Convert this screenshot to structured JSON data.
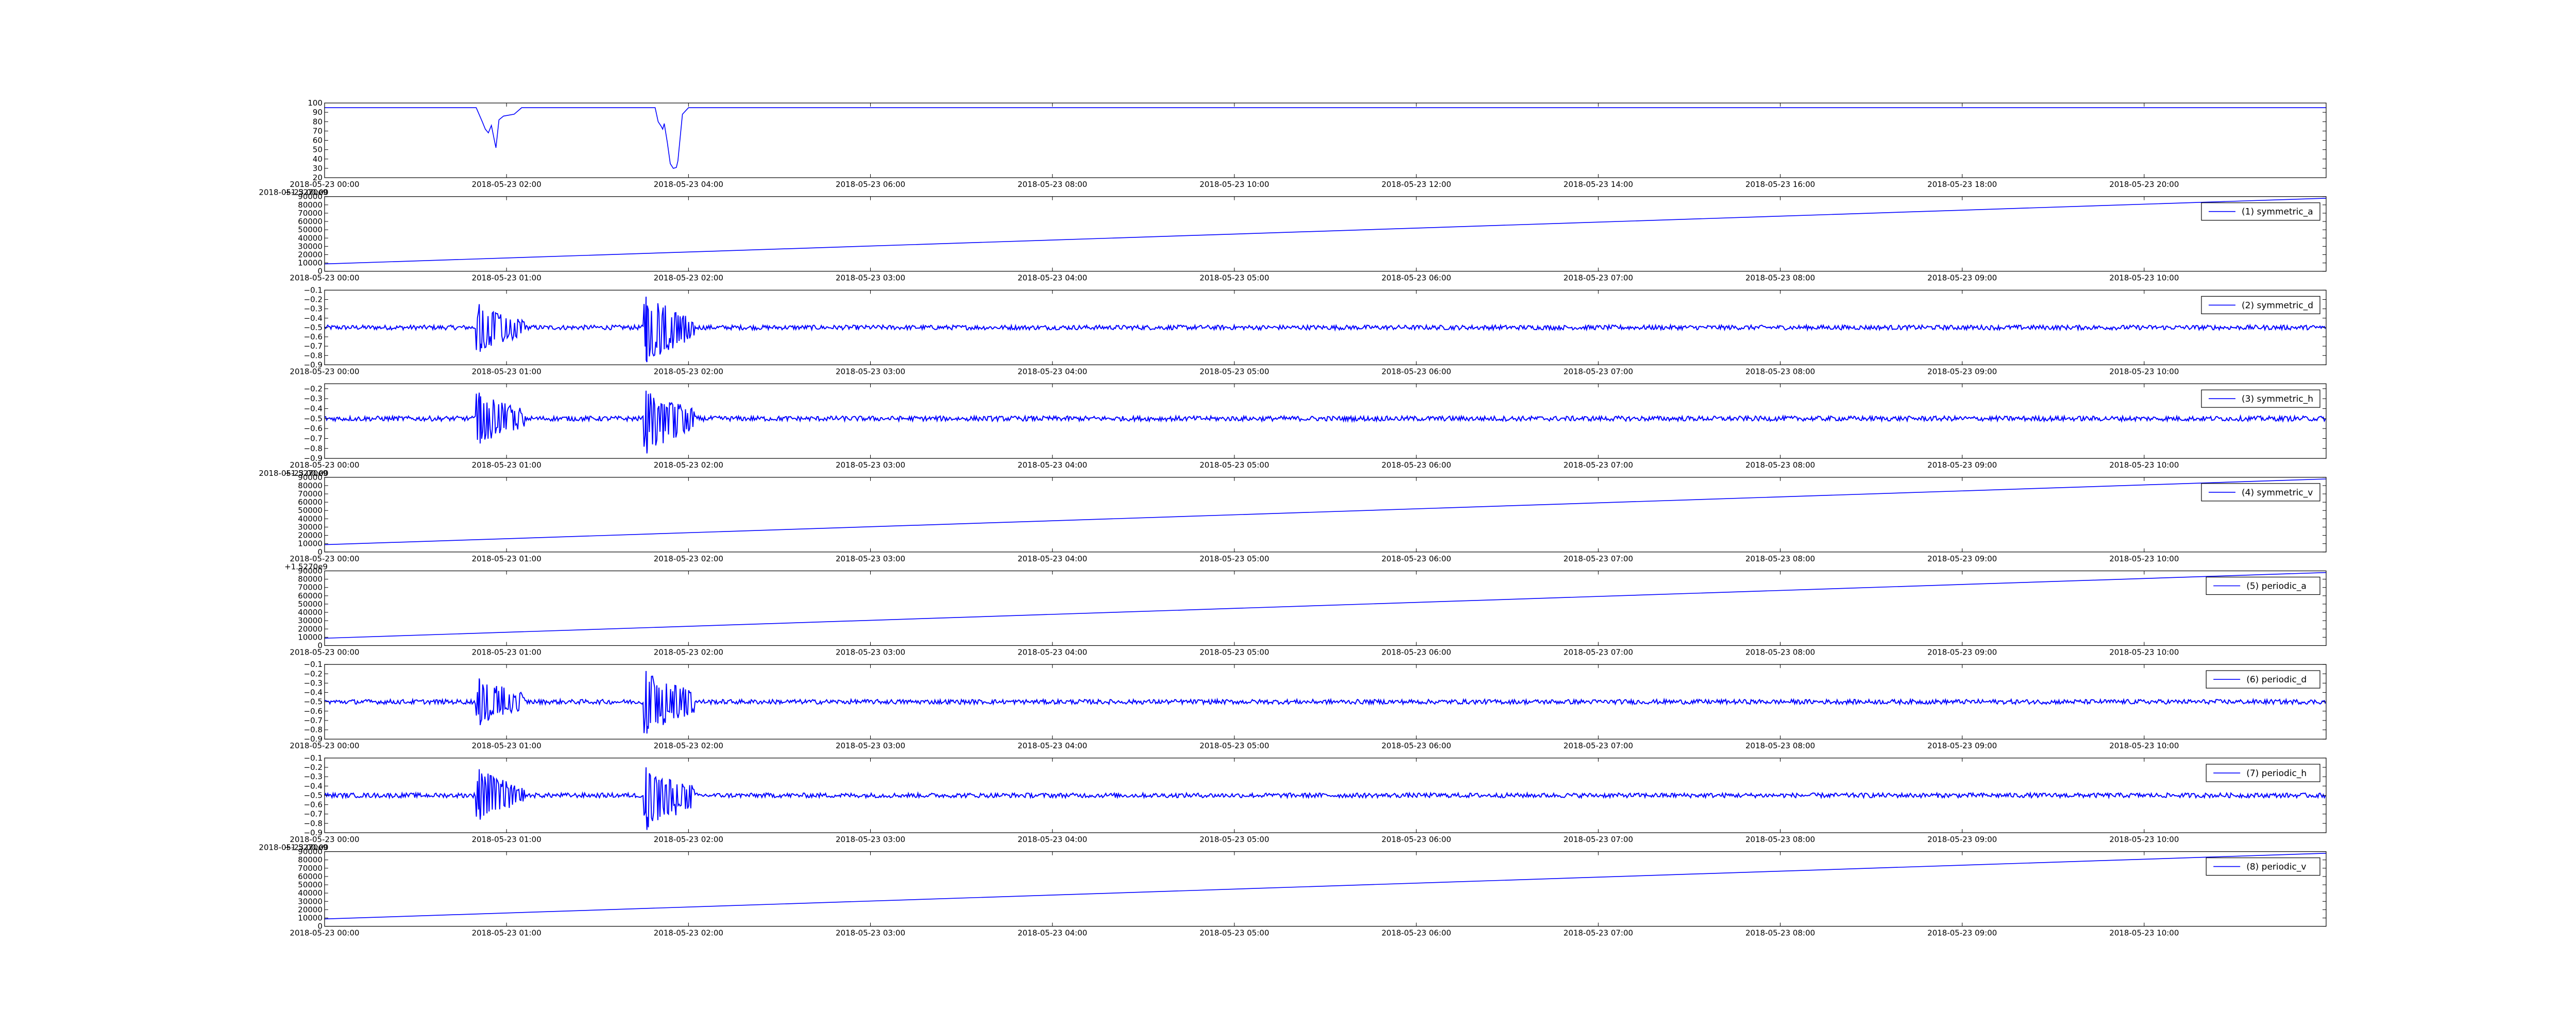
{
  "chart_data": [
    {
      "type": "line",
      "title": "",
      "xlabel": "",
      "ylabel": "",
      "x_ticks": [
        "2018-05-23 00:00",
        "2018-05-23 02:00",
        "2018-05-23 04:00",
        "2018-05-23 06:00",
        "2018-05-23 08:00",
        "2018-05-23 10:00",
        "2018-05-23 12:00",
        "2018-05-23 14:00",
        "2018-05-23 16:00",
        "2018-05-23 18:00",
        "2018-05-23 20:00"
      ],
      "xlim": [
        "2018-05-23 00:00",
        "2018-05-23 22:00"
      ],
      "y_ticks": [
        "20",
        "30",
        "40",
        "50",
        "60",
        "70",
        "80",
        "90",
        "100"
      ],
      "ylim": [
        20,
        100
      ],
      "offset_label": "",
      "grid": false,
      "legend": "",
      "series": [
        {
          "color": "#0000ff",
          "x": [
            "2018-05-23 00:00",
            "2018-05-23 01:40",
            "2018-05-23 01:44",
            "2018-05-23 01:46",
            "2018-05-23 01:48",
            "2018-05-23 01:50",
            "2018-05-23 01:52",
            "2018-05-23 01:53",
            "2018-05-23 01:55",
            "2018-05-23 01:58",
            "2018-05-23 02:05",
            "2018-05-23 02:10",
            "2018-05-23 02:12",
            "2018-05-23 03:38",
            "2018-05-23 03:40",
            "2018-05-23 03:42",
            "2018-05-23 03:43",
            "2018-05-23 03:44",
            "2018-05-23 03:46",
            "2018-05-23 03:48",
            "2018-05-23 03:50",
            "2018-05-23 03:52",
            "2018-05-23 03:53",
            "2018-05-23 03:56",
            "2018-05-23 04:00",
            "2018-05-23 04:05",
            "2018-05-23 22:00"
          ],
          "y": [
            95,
            95,
            80,
            72,
            68,
            76,
            60,
            52,
            82,
            86,
            88,
            95,
            95,
            95,
            80,
            75,
            72,
            78,
            58,
            35,
            30,
            31,
            38,
            88,
            95,
            95,
            95
          ]
        }
      ]
    },
    {
      "type": "line",
      "title": "",
      "xlabel": "",
      "ylabel": "",
      "x_ticks": [
        "2018-05-23 00:00",
        "2018-05-23 01:00",
        "2018-05-23 02:00",
        "2018-05-23 03:00",
        "2018-05-23 04:00",
        "2018-05-23 05:00",
        "2018-05-23 06:00",
        "2018-05-23 07:00",
        "2018-05-23 08:00",
        "2018-05-23 09:00",
        "2018-05-23 10:00"
      ],
      "xlim": [
        "2018-05-23 00:00",
        "2018-05-23 11:00"
      ],
      "y_ticks": [
        "0",
        "10000",
        "20000",
        "30000",
        "40000",
        "50000",
        "60000",
        "70000",
        "80000",
        "90000"
      ],
      "ylim": [
        0,
        90000
      ],
      "offset_label": "+1.5270e9",
      "offset_label_first_tick_overlap": "2018-05-23 00:00",
      "grid": false,
      "legend": "upper right",
      "series": [
        {
          "name": "(1) symmetric_a",
          "color": "#0000ff",
          "x": [
            "2018-05-23 00:00",
            "2018-05-23 11:00"
          ],
          "y": [
            8800,
            88000
          ]
        }
      ]
    },
    {
      "type": "line",
      "title": "",
      "xlabel": "",
      "ylabel": "",
      "x_ticks": [
        "2018-05-23 00:00",
        "2018-05-23 01:00",
        "2018-05-23 02:00",
        "2018-05-23 03:00",
        "2018-05-23 04:00",
        "2018-05-23 05:00",
        "2018-05-23 06:00",
        "2018-05-23 07:00",
        "2018-05-23 08:00",
        "2018-05-23 09:00",
        "2018-05-23 10:00"
      ],
      "xlim": [
        "2018-05-23 00:00",
        "2018-05-23 11:00"
      ],
      "y_ticks": [
        "−0.9",
        "−0.8",
        "−0.7",
        "−0.6",
        "−0.5",
        "−0.4",
        "−0.3",
        "−0.2",
        "−0.1"
      ],
      "ylim": [
        -0.9,
        -0.1
      ],
      "offset_label": "",
      "grid": false,
      "legend": "upper right",
      "series": [
        {
          "name": "(2) symmetric_d",
          "color": "#0000ff",
          "baseline": -0.5,
          "noise_amplitude": 0.025,
          "bursts": [
            {
              "start": "2018-05-23 00:50",
              "end": "2018-05-23 01:06",
              "min": -0.76,
              "max": -0.25
            },
            {
              "start": "2018-05-23 01:45",
              "end": "2018-05-23 02:02",
              "min": -0.87,
              "max": -0.17
            }
          ]
        }
      ]
    },
    {
      "type": "line",
      "title": "",
      "xlabel": "",
      "ylabel": "",
      "x_ticks": [
        "2018-05-23 00:00",
        "2018-05-23 01:00",
        "2018-05-23 02:00",
        "2018-05-23 03:00",
        "2018-05-23 04:00",
        "2018-05-23 05:00",
        "2018-05-23 06:00",
        "2018-05-23 07:00",
        "2018-05-23 08:00",
        "2018-05-23 09:00",
        "2018-05-23 10:00"
      ],
      "xlim": [
        "2018-05-23 00:00",
        "2018-05-23 11:00"
      ],
      "y_ticks": [
        "−0.9",
        "−0.8",
        "−0.7",
        "−0.6",
        "−0.5",
        "−0.4",
        "−0.3",
        "−0.2"
      ],
      "ylim": [
        -0.9,
        -0.15
      ],
      "offset_label": "",
      "grid": false,
      "legend": "upper right",
      "series": [
        {
          "name": "(3) symmetric_h",
          "color": "#0000ff",
          "baseline": -0.5,
          "noise_amplitude": 0.025,
          "bursts": [
            {
              "start": "2018-05-23 00:50",
              "end": "2018-05-23 01:06",
              "min": -0.75,
              "max": -0.24
            },
            {
              "start": "2018-05-23 01:45",
              "end": "2018-05-23 02:02",
              "min": -0.85,
              "max": -0.22
            }
          ]
        }
      ]
    },
    {
      "type": "line",
      "title": "",
      "xlabel": "",
      "ylabel": "",
      "x_ticks": [
        "2018-05-23 00:00",
        "2018-05-23 01:00",
        "2018-05-23 02:00",
        "2018-05-23 03:00",
        "2018-05-23 04:00",
        "2018-05-23 05:00",
        "2018-05-23 06:00",
        "2018-05-23 07:00",
        "2018-05-23 08:00",
        "2018-05-23 09:00",
        "2018-05-23 10:00"
      ],
      "xlim": [
        "2018-05-23 00:00",
        "2018-05-23 11:00"
      ],
      "y_ticks": [
        "0",
        "10000",
        "20000",
        "30000",
        "40000",
        "50000",
        "60000",
        "70000",
        "80000",
        "90000"
      ],
      "ylim": [
        0,
        90000
      ],
      "offset_label": "+1.5270e9",
      "offset_label_first_tick_overlap": "2018-05-23 00:00",
      "grid": false,
      "legend": "upper right",
      "series": [
        {
          "name": "(4) symmetric_v",
          "color": "#0000ff",
          "x": [
            "2018-05-23 00:00",
            "2018-05-23 11:00"
          ],
          "y": [
            8800,
            88000
          ]
        }
      ]
    },
    {
      "type": "line",
      "title": "",
      "xlabel": "",
      "ylabel": "",
      "x_ticks": [
        "2018-05-23 00:00",
        "2018-05-23 01:00",
        "2018-05-23 02:00",
        "2018-05-23 03:00",
        "2018-05-23 04:00",
        "2018-05-23 05:00",
        "2018-05-23 06:00",
        "2018-05-23 07:00",
        "2018-05-23 08:00",
        "2018-05-23 09:00",
        "2018-05-23 10:00"
      ],
      "xlim": [
        "2018-05-23 00:00",
        "2018-05-23 11:00"
      ],
      "y_ticks": [
        "0",
        "10000",
        "20000",
        "30000",
        "40000",
        "50000",
        "60000",
        "70000",
        "80000",
        "90000"
      ],
      "ylim": [
        0,
        90000
      ],
      "offset_label": "+1.5270e9",
      "offset_label_first_tick_overlap": "",
      "grid": false,
      "legend": "upper right",
      "series": [
        {
          "name": "(5) periodic_a",
          "color": "#0000ff",
          "x": [
            "2018-05-23 00:00",
            "2018-05-23 11:00"
          ],
          "y": [
            8800,
            88000
          ]
        }
      ]
    },
    {
      "type": "line",
      "title": "",
      "xlabel": "",
      "ylabel": "",
      "x_ticks": [
        "2018-05-23 00:00",
        "2018-05-23 01:00",
        "2018-05-23 02:00",
        "2018-05-23 03:00",
        "2018-05-23 04:00",
        "2018-05-23 05:00",
        "2018-05-23 06:00",
        "2018-05-23 07:00",
        "2018-05-23 08:00",
        "2018-05-23 09:00",
        "2018-05-23 10:00"
      ],
      "xlim": [
        "2018-05-23 00:00",
        "2018-05-23 11:00"
      ],
      "y_ticks": [
        "−0.9",
        "−0.8",
        "−0.7",
        "−0.6",
        "−0.5",
        "−0.4",
        "−0.3",
        "−0.2",
        "−0.1"
      ],
      "ylim": [
        -0.9,
        -0.1
      ],
      "offset_label": "",
      "grid": false,
      "legend": "upper right",
      "series": [
        {
          "name": "(6) periodic_d",
          "color": "#0000ff",
          "baseline": -0.5,
          "noise_amplitude": 0.025,
          "bursts": [
            {
              "start": "2018-05-23 00:50",
              "end": "2018-05-23 01:06",
              "min": -0.75,
              "max": -0.25
            },
            {
              "start": "2018-05-23 01:45",
              "end": "2018-05-23 02:02",
              "min": -0.84,
              "max": -0.17
            }
          ]
        }
      ]
    },
    {
      "type": "line",
      "title": "",
      "xlabel": "",
      "ylabel": "",
      "x_ticks": [
        "2018-05-23 00:00",
        "2018-05-23 01:00",
        "2018-05-23 02:00",
        "2018-05-23 03:00",
        "2018-05-23 04:00",
        "2018-05-23 05:00",
        "2018-05-23 06:00",
        "2018-05-23 07:00",
        "2018-05-23 08:00",
        "2018-05-23 09:00",
        "2018-05-23 10:00"
      ],
      "xlim": [
        "2018-05-23 00:00",
        "2018-05-23 11:00"
      ],
      "y_ticks": [
        "−0.9",
        "−0.8",
        "−0.7",
        "−0.6",
        "−0.5",
        "−0.4",
        "−0.3",
        "−0.2",
        "−0.1"
      ],
      "ylim": [
        -0.9,
        -0.1
      ],
      "offset_label": "",
      "grid": false,
      "legend": "upper right",
      "series": [
        {
          "name": "(7) periodic_h",
          "color": "#0000ff",
          "baseline": -0.5,
          "noise_amplitude": 0.025,
          "bursts": [
            {
              "start": "2018-05-23 00:50",
              "end": "2018-05-23 01:06",
              "min": -0.76,
              "max": -0.22
            },
            {
              "start": "2018-05-23 01:45",
              "end": "2018-05-23 02:02",
              "min": -0.87,
              "max": -0.2
            }
          ]
        }
      ]
    },
    {
      "type": "line",
      "title": "",
      "xlabel": "",
      "ylabel": "",
      "x_ticks": [
        "2018-05-23 00:00",
        "2018-05-23 01:00",
        "2018-05-23 02:00",
        "2018-05-23 03:00",
        "2018-05-23 04:00",
        "2018-05-23 05:00",
        "2018-05-23 06:00",
        "2018-05-23 07:00",
        "2018-05-23 08:00",
        "2018-05-23 09:00",
        "2018-05-23 10:00"
      ],
      "xlim": [
        "2018-05-23 00:00",
        "2018-05-23 11:00"
      ],
      "y_ticks": [
        "0",
        "10000",
        "20000",
        "30000",
        "40000",
        "50000",
        "60000",
        "70000",
        "80000",
        "90000"
      ],
      "ylim": [
        0,
        90000
      ],
      "offset_label": "+1.5270e9",
      "offset_label_first_tick_overlap": "2018-05-23 00:00",
      "grid": false,
      "legend": "upper right",
      "series": [
        {
          "name": "(8) periodic_v",
          "color": "#0000ff",
          "x": [
            "2018-05-23 00:00",
            "2018-05-23 11:00"
          ],
          "y": [
            8800,
            88000
          ]
        }
      ]
    }
  ]
}
